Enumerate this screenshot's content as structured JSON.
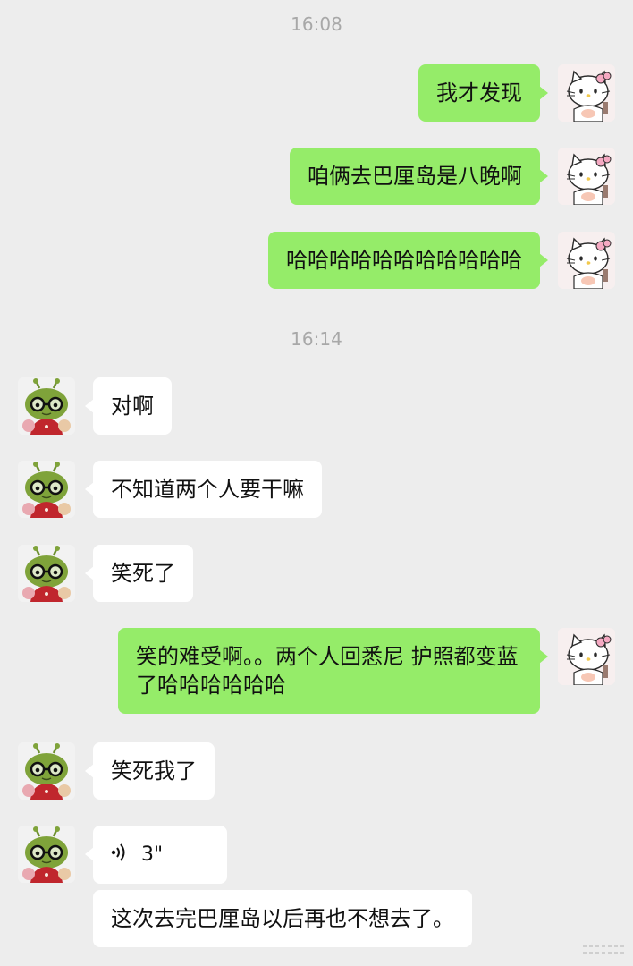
{
  "timestamps": [
    "16:08",
    "16:14"
  ],
  "messages": [
    {
      "sender": "me",
      "text": "我才发现"
    },
    {
      "sender": "me",
      "text": "咱俩去巴厘岛是八晚啊"
    },
    {
      "sender": "me",
      "text": "哈哈哈哈哈哈哈哈哈哈哈"
    },
    {
      "sender": "other",
      "text": "对啊"
    },
    {
      "sender": "other",
      "text": "不知道两个人要干嘛"
    },
    {
      "sender": "other",
      "text": "笑死了"
    },
    {
      "sender": "me",
      "text": "笑的难受啊。。两个人回悉尼 护照都变蓝了哈哈哈哈哈哈"
    },
    {
      "sender": "other",
      "text": "笑死我了"
    },
    {
      "sender": "other",
      "type": "voice",
      "duration": "3\"",
      "transcript": "这次去完巴厘岛以后再也不想去了。"
    }
  ],
  "avatars": {
    "me": "hello-kitty-avatar",
    "other": "green-bug-avatar"
  },
  "colors": {
    "background": "#EDEDED",
    "my_bubble": "#95EC69",
    "other_bubble": "#FFFFFF",
    "timestamp": "#A8A8A8"
  }
}
